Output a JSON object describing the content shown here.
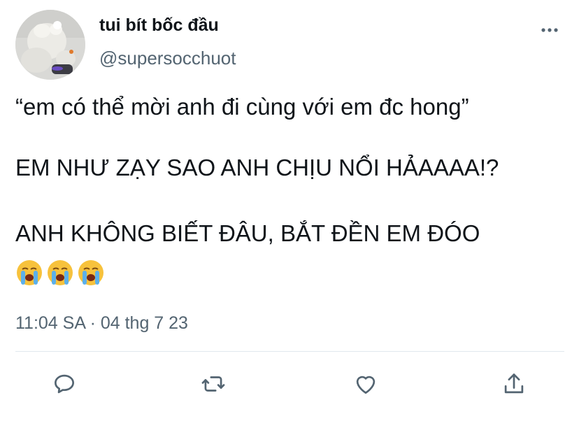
{
  "author": {
    "display_name": "tui bít bốc đầu",
    "handle": "@supersocchuot"
  },
  "tweet": {
    "line1": "“em có thể mời anh đi cùng với em đc hong”",
    "line2": "EM NHƯ ZẠY SAO ANH CHỊU NỔI HẢAAAA!?",
    "line3": "ANH KHÔNG BIẾT ĐÂU, BẮT ĐỀN EM ĐÓO",
    "emojis": [
      "loudly-crying-face",
      "loudly-crying-face",
      "loudly-crying-face"
    ]
  },
  "timestamp": "11:04 SA · 04 thg 7 23",
  "actions": {
    "reply_icon": "reply-icon",
    "retweet_icon": "retweet-icon",
    "like_icon": "heart-icon",
    "share_icon": "share-icon",
    "more_icon": "more-icon"
  },
  "colors": {
    "text": "#0f1419",
    "secondary": "#536471",
    "divider": "#e1e8ed"
  }
}
